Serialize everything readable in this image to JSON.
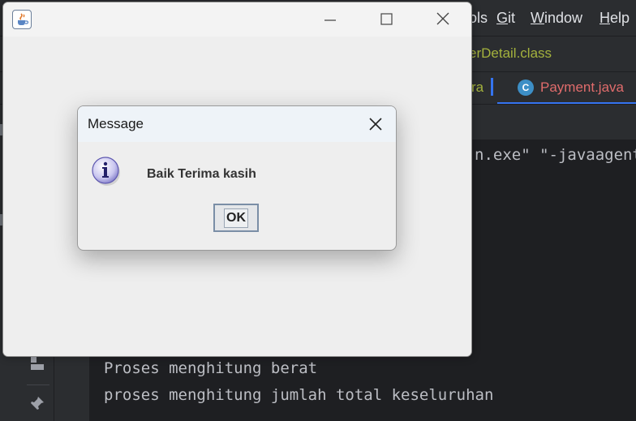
{
  "ide": {
    "menu": [
      {
        "label": "ols",
        "underline": ""
      },
      {
        "label": "Git",
        "underline": "G"
      },
      {
        "label": "Window",
        "underline": "W"
      },
      {
        "label": "Help",
        "underline": "H"
      }
    ],
    "breadcrumb": "erDetail.class",
    "tab_partial": "ra",
    "active_tab": {
      "icon_letter": "C",
      "label": "Payment.java"
    },
    "console_lines": [
      "n.exe\" \"-javaagent",
      "Proses menghitung berat",
      "proses menghitung jumlah total keseluruhan"
    ],
    "gutter_icons": [
      "layout-icon",
      "pin-icon"
    ]
  },
  "frame": {
    "title": "",
    "icon": "java-cup-icon",
    "controls": [
      "minimize-icon",
      "maximize-icon",
      "close-icon"
    ]
  },
  "dialog": {
    "title": "Message",
    "message": "Baik Terima kasih",
    "icon": "info-icon",
    "ok_label": "OK"
  },
  "colors": {
    "ide_bg": "#2b2d30",
    "console_bg": "#1e1f22",
    "breadcrumb": "#a4b23d",
    "tab_error_text": "#e06c6c",
    "accent": "#3574f0"
  }
}
